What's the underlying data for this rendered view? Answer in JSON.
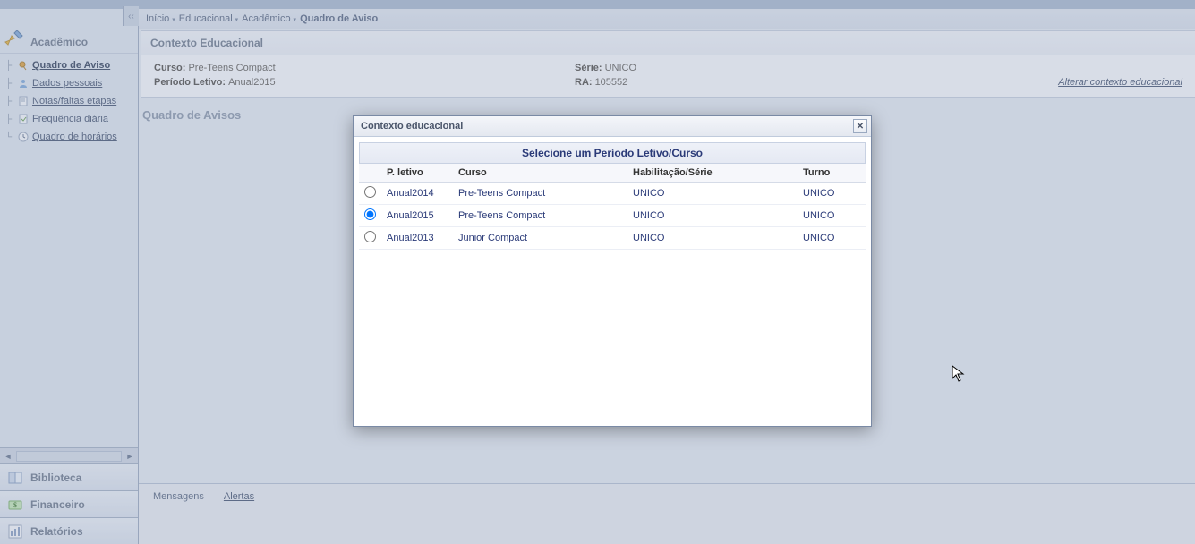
{
  "breadcrumbs": {
    "items": [
      "Início",
      "Educacional",
      "Acadêmico"
    ],
    "current": "Quadro de Aviso"
  },
  "sidebar": {
    "header": "Acadêmico",
    "tree": [
      {
        "label": "Quadro de Aviso",
        "active": true
      },
      {
        "label": "Dados pessoais",
        "active": false
      },
      {
        "label": "Notas/faltas etapas",
        "active": false
      },
      {
        "label": "Frequência diária",
        "active": false
      },
      {
        "label": "Quadro de horários",
        "active": false
      }
    ],
    "sections": [
      {
        "label": "Biblioteca"
      },
      {
        "label": "Financeiro"
      },
      {
        "label": "Relatórios"
      }
    ]
  },
  "context_panel": {
    "title": "Contexto Educacional",
    "curso": {
      "label": "Curso:",
      "value": "Pre-Teens Compact"
    },
    "periodo": {
      "label": "Período Letivo:",
      "value": "Anual2015"
    },
    "serie": {
      "label": "Série:",
      "value": "UNICO"
    },
    "ra": {
      "label": "RA:",
      "value": "105552"
    },
    "change_link": "Alterar contexto educacional"
  },
  "section_title": "Quadro de Avisos",
  "bottom_tabs": {
    "mensagens": "Mensagens",
    "alertas": "Alertas"
  },
  "modal": {
    "title": "Contexto educacional",
    "subtitle": "Selecione um Período Letivo/Curso",
    "columns": {
      "radio": "",
      "p_letivo": "P. letivo",
      "curso": "Curso",
      "habilitacao": "Habilitação/Série",
      "turno": "Turno"
    },
    "rows": [
      {
        "p_letivo": "Anual2014",
        "curso": "Pre-Teens Compact",
        "habilitacao": "UNICO",
        "turno": "UNICO",
        "selected": false
      },
      {
        "p_letivo": "Anual2015",
        "curso": "Pre-Teens Compact",
        "habilitacao": "UNICO",
        "turno": "UNICO",
        "selected": true
      },
      {
        "p_letivo": "Anual2013",
        "curso": "Junior Compact",
        "habilitacao": "UNICO",
        "turno": "UNICO",
        "selected": false
      }
    ]
  }
}
